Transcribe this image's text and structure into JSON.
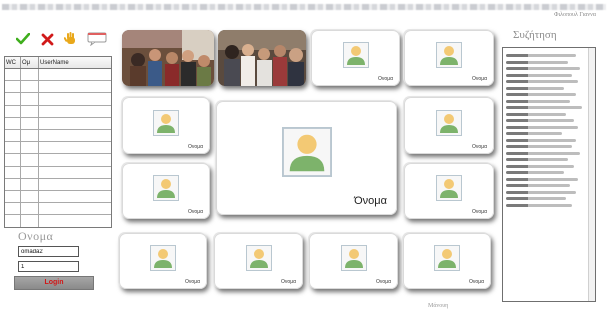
{
  "header": {
    "right_text": "Φιλοπουλ Γιαννα"
  },
  "toolbar": {
    "icons": [
      "check-icon",
      "cross-icon",
      "hand-icon",
      "chat-bubble-icon"
    ],
    "colors": {
      "check": "#3fae1d",
      "cross": "#d11a1a",
      "hand": "#e9a81b"
    }
  },
  "user_table": {
    "columns": [
      "WC",
      "Ομ",
      "UserName"
    ],
    "rows": [
      "",
      "",
      "",
      "",
      "",
      "",
      "",
      "",
      "",
      "",
      "",
      "",
      ""
    ]
  },
  "login": {
    "title": "Ονομα",
    "username_value": "omada2",
    "password_value": "1",
    "button_label": "Login"
  },
  "video_grid": {
    "tile_name": "Ονομα",
    "main_name": "Όνομα",
    "photo_tiles": [
      "photo-1",
      "photo-2"
    ],
    "avatar_colors": {
      "head": "#f3c974",
      "body": "#7db36b",
      "frame": "#b9c7d0"
    }
  },
  "chat": {
    "title": "Συζήτηση"
  },
  "footer": {
    "label": "Μάνουη"
  }
}
